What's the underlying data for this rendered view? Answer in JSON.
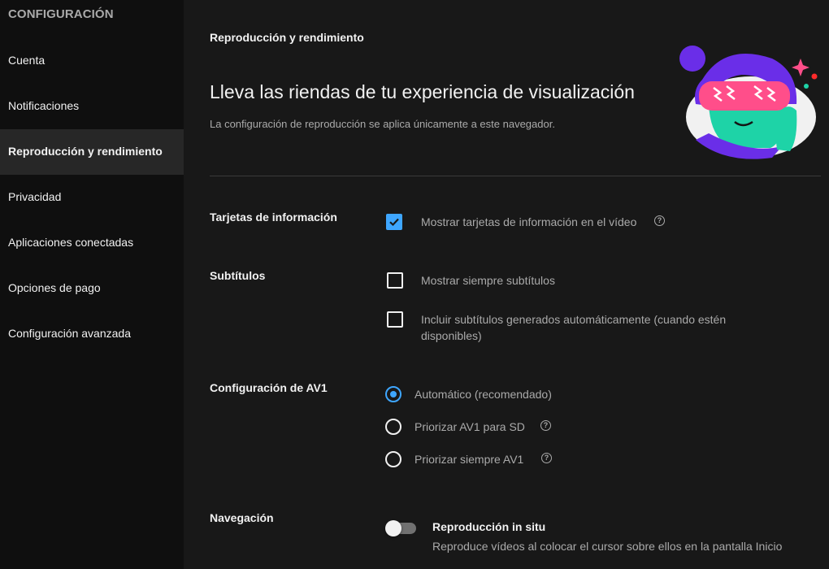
{
  "sidebar": {
    "heading": "CONFIGURACIÓN",
    "items": [
      {
        "label": "Cuenta"
      },
      {
        "label": "Notificaciones"
      },
      {
        "label": "Reproducción y rendimiento"
      },
      {
        "label": "Privacidad"
      },
      {
        "label": "Aplicaciones conectadas"
      },
      {
        "label": "Opciones de pago"
      },
      {
        "label": "Configuración avanzada"
      }
    ],
    "active_index": 2
  },
  "main": {
    "section_label": "Reproducción y rendimiento",
    "title": "Lleva las riendas de tu experiencia de visualización",
    "description": "La configuración de reproducción se aplica únicamente a este navegador.",
    "info_cards": {
      "label": "Tarjetas de información",
      "option": {
        "text": "Mostrar tarjetas de información en el vídeo",
        "checked": true
      }
    },
    "subtitles": {
      "label": "Subtítulos",
      "options": [
        {
          "text": "Mostrar siempre subtítulos",
          "checked": false
        },
        {
          "line1": "Incluir subtítulos generados automáticamente (cuando estén",
          "line2": "disponibles)",
          "checked": false
        }
      ]
    },
    "av1": {
      "label": "Configuración de AV1",
      "options": [
        {
          "text": "Automático (recomendado)",
          "selected": true
        },
        {
          "text": "Priorizar AV1 para SD",
          "selected": false
        },
        {
          "text": "Priorizar siempre AV1",
          "selected": false
        }
      ]
    },
    "navigation": {
      "label": "Navegación",
      "toggle_title": "Reproducción in situ",
      "toggle_desc": "Reproduce vídeos al colocar el cursor sobre ellos en la pantalla Inicio",
      "enabled": false
    }
  },
  "icons": {
    "help": "help-circle-icon",
    "check": "check-icon"
  },
  "colors": {
    "accent": "#3ea6ff",
    "background": "#181818",
    "sidebar": "#0f0f0f",
    "active_item": "#272727"
  }
}
